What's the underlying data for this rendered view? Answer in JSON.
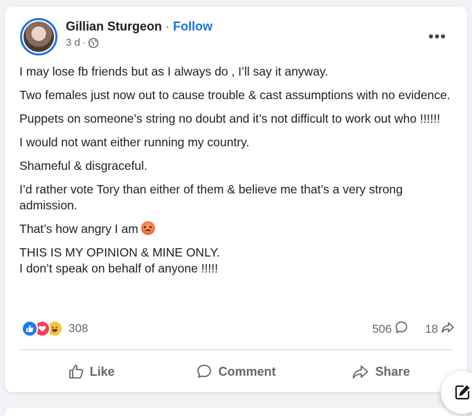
{
  "post": {
    "author": "Gillian Sturgeon",
    "separator": "·",
    "follow_label": "Follow",
    "time": "3 d",
    "time_sep": "·",
    "privacy_icon": "globe-icon",
    "paragraphs": [
      "I may lose fb friends but as I always do , I’ll say it anyway.",
      "Two females just now out to cause trouble & cast  assumptions with no evidence.",
      "Puppets on someone’s string no doubt and it’s not difficult to work out who !!!!!!",
      "I would  not want either running my country.",
      "Shameful & disgraceful.",
      "I’d rather vote Tory than either of them & believe me that’s a very strong admission."
    ],
    "angry_line": "That’s how angry I am",
    "closing_line_1": "THIS IS MY OPINION & MINE ONLY.",
    "closing_line_2": "I don’t speak on behalf of anyone !!!!!"
  },
  "reactions": {
    "types": [
      "like",
      "love",
      "haha"
    ],
    "count": "308"
  },
  "stats": {
    "comments": "506",
    "shares": "18"
  },
  "actions": {
    "like": "Like",
    "comment": "Comment",
    "share": "Share"
  },
  "colors": {
    "accent": "#1b74e4",
    "secondary_text": "#65676b",
    "background": "#f0f2f5"
  }
}
